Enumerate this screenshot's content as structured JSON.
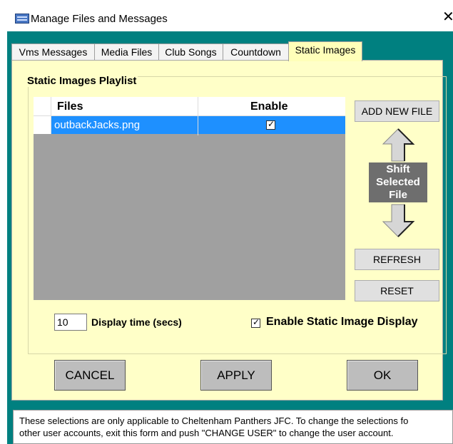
{
  "window": {
    "title": "Manage Files and Messages",
    "close_glyph": "✕"
  },
  "tabs": [
    {
      "label": "Vms Messages"
    },
    {
      "label": "Media Files"
    },
    {
      "label": "Club Songs"
    },
    {
      "label": "Countdown"
    },
    {
      "label": "Static Images",
      "active": true
    }
  ],
  "playlist": {
    "title": "Static Images Playlist",
    "columns": {
      "files": "Files",
      "enable": "Enable"
    },
    "rows": [
      {
        "file": "outbackJacks.png",
        "enabled": true
      }
    ]
  },
  "side_buttons": {
    "add_new_file": "ADD NEW FILE",
    "shift_lines": [
      "Shift",
      "Selected",
      "File"
    ],
    "refresh": "REFRESH",
    "reset": "RESET"
  },
  "display_time": {
    "value": "10",
    "label": "Display time (secs)"
  },
  "enable_static": {
    "checked": true,
    "label": "Enable Static Image Display"
  },
  "footer_buttons": {
    "cancel": "CANCEL",
    "apply": "APPLY",
    "ok": "OK"
  },
  "status": {
    "line1": "These selections are only applicable to Cheltenham Panthers JFC. To change the selections fo",
    "line2": "other user accounts, exit this form and push \"CHANGE USER\" to change the user account."
  },
  "colors": {
    "window_bg": "#008080",
    "panel_bg": "#ffffc8",
    "selection": "#1e90ff",
    "shift_bg": "#6e6e6e"
  },
  "icons": {
    "app": "app-window-icon",
    "close": "close-icon",
    "up": "arrow-up-icon",
    "down": "arrow-down-icon",
    "check": "checkmark-icon"
  }
}
